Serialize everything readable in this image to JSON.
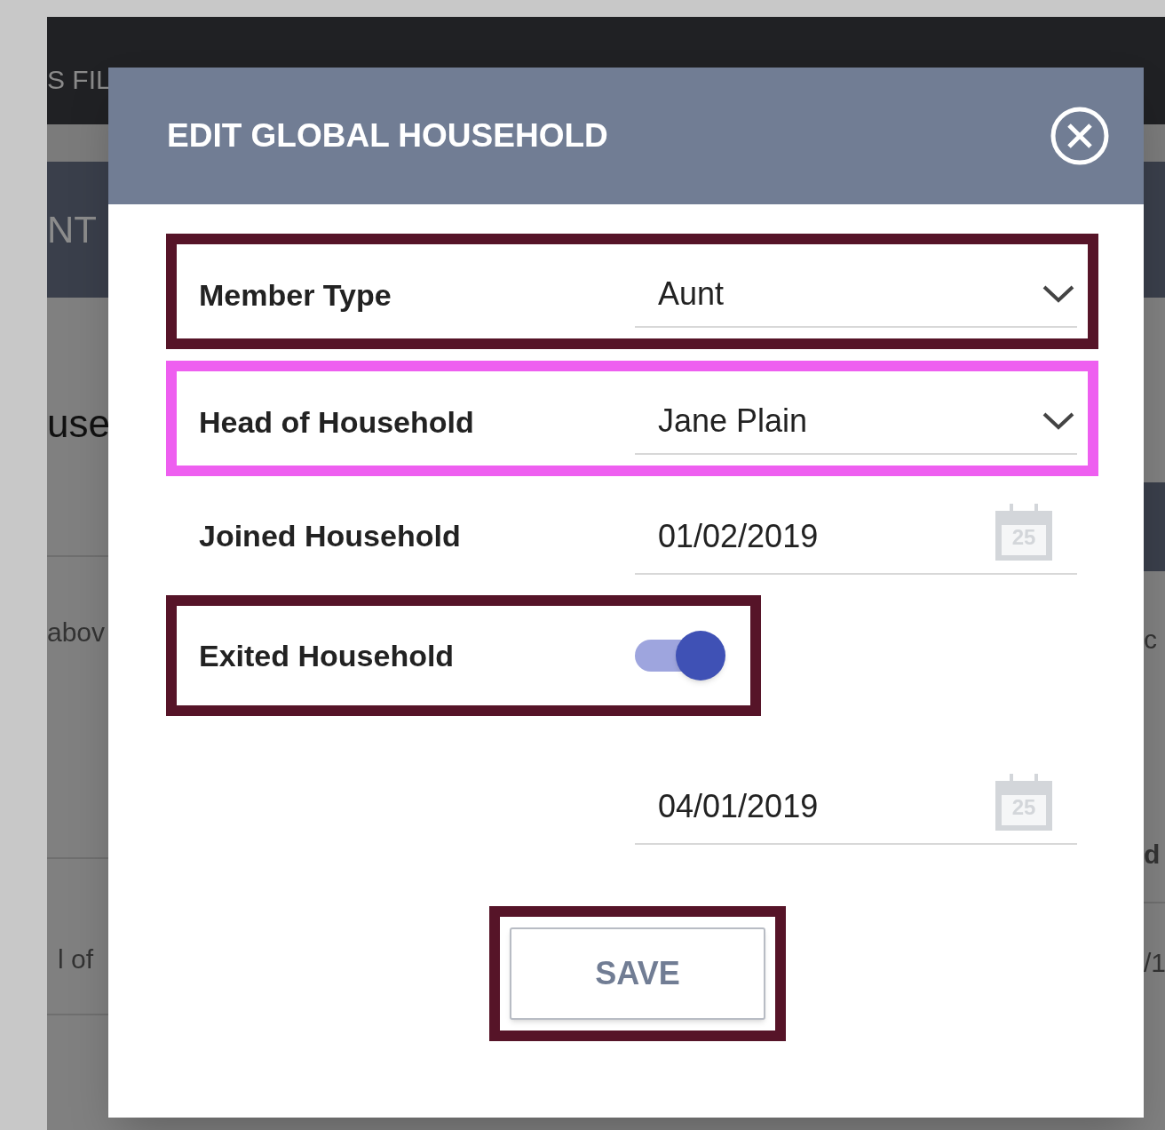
{
  "background": {
    "nav_text": "S FIL",
    "header_text": "NT",
    "texts_left": [
      "use",
      "abov",
      "l of"
    ],
    "texts_right": [
      "c",
      "d",
      "/1"
    ]
  },
  "dialog": {
    "title": "EDIT GLOBAL HOUSEHOLD",
    "fields": [
      {
        "kind": "select",
        "label": "Member Type",
        "value": "Aunt",
        "color": "#561428"
      },
      {
        "kind": "select",
        "label": "Head of Household",
        "value": "Jane Plain",
        "color": "#ee5ff0"
      },
      {
        "kind": "date",
        "label": "Joined Household",
        "value": "01/02/2019",
        "calendar_day": "25"
      },
      {
        "kind": "toggle",
        "label": "Exited Household",
        "on": true,
        "color": "#561428"
      },
      {
        "kind": "date",
        "value": "04/01/2019",
        "calendar_day": "25"
      }
    ],
    "save": {
      "label": "SAVE",
      "color": "#561428"
    }
  }
}
